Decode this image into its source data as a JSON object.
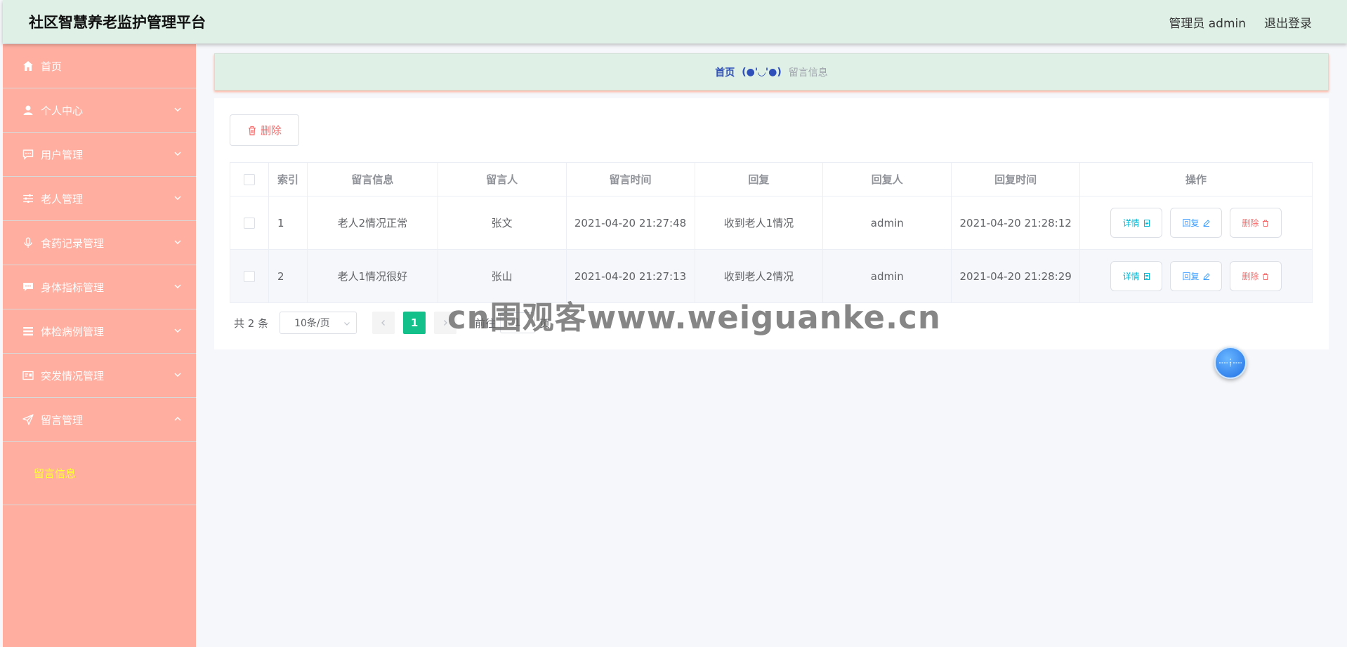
{
  "header": {
    "title": "社区智慧养老监护管理平台",
    "admin_label": "管理员 admin",
    "logout_label": "退出登录"
  },
  "sidebar": {
    "items": [
      {
        "label": "首页",
        "icon": "home-icon"
      },
      {
        "label": "个人中心",
        "icon": "user-icon"
      },
      {
        "label": "用户管理",
        "icon": "chat-icon"
      },
      {
        "label": "老人管理",
        "icon": "sliders-icon"
      },
      {
        "label": "食药记录管理",
        "icon": "microphone-icon"
      },
      {
        "label": "身体指标管理",
        "icon": "message-icon"
      },
      {
        "label": "体检病例管理",
        "icon": "list-icon"
      },
      {
        "label": "突发情况管理",
        "icon": "card-icon"
      },
      {
        "label": "留言管理",
        "icon": "send-icon"
      }
    ],
    "sub_item": "留言信息"
  },
  "breadcrumb": {
    "home": "首页",
    "separator": "(●'◡'●)",
    "current": "留言信息"
  },
  "toolbar": {
    "delete_label": "删除"
  },
  "table": {
    "headers": [
      "索引",
      "留言信息",
      "留言人",
      "留言时间",
      "回复",
      "回复人",
      "回复时间",
      "操作"
    ],
    "rows": [
      {
        "index": "1",
        "message": "老人2情况正常",
        "author": "张文",
        "time": "2021-04-20 21:27:48",
        "reply": "收到老人1情况",
        "replier": "admin",
        "reply_time": "2021-04-20 21:28:12"
      },
      {
        "index": "2",
        "message": "老人1情况很好",
        "author": "张山",
        "time": "2021-04-20 21:27:13",
        "reply": "收到老人2情况",
        "replier": "admin",
        "reply_time": "2021-04-20 21:28:29"
      }
    ],
    "actions": {
      "detail": "详情",
      "reply": "回复",
      "delete": "删除"
    }
  },
  "pagination": {
    "total_label": "共 2 条",
    "page_size": "10条/页",
    "current_page": "1",
    "goto_prefix": "前往",
    "goto_value": "1",
    "goto_suffix": "页"
  },
  "watermark": "cn围观客www.weiguanke.cn",
  "colors": {
    "sidebar_bg": "#ffaea0",
    "header_bg": "#dff0e6",
    "active_page": "#13c08a",
    "submenu_active": "#ffff33"
  }
}
